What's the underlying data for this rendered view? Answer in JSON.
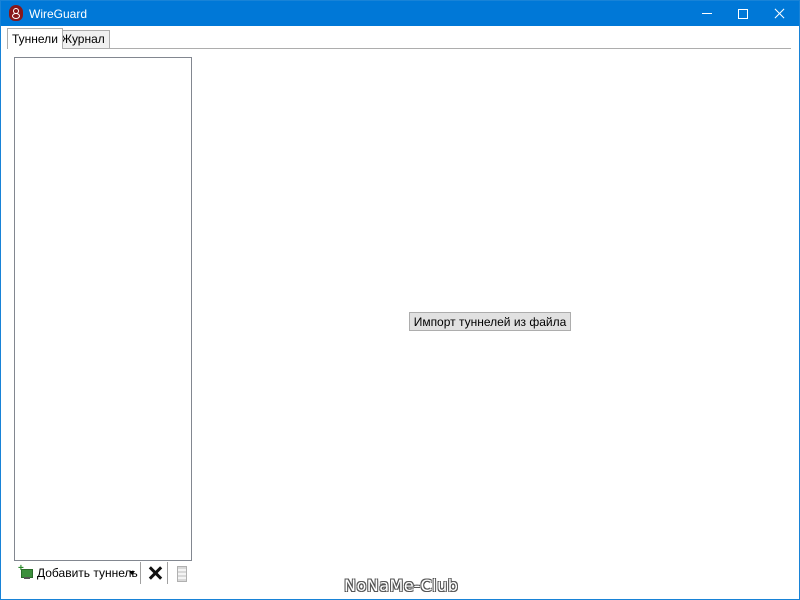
{
  "window": {
    "title": "WireGuard",
    "accent": "#0078d7",
    "app_icon": "wireguard-dragon-icon"
  },
  "tabs": [
    {
      "label": "Туннели",
      "active": true
    },
    {
      "label": "Журнал",
      "active": false
    }
  ],
  "toolbar": {
    "add_label": "Добавить туннель",
    "add_icon": "add-tunnel-icon",
    "delete_icon": "delete-x-icon",
    "export_icon": "export-zip-icon"
  },
  "main": {
    "import_button_label": "Импорт туннелей из файла"
  },
  "watermark": "NoNaMe-Club"
}
